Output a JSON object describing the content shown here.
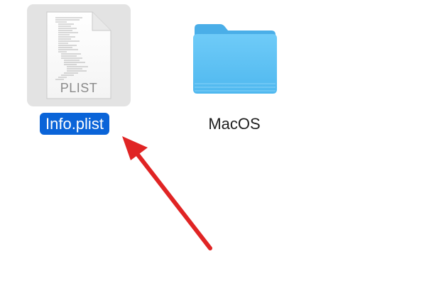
{
  "files": [
    {
      "name": "Info.plist",
      "icon": "plist-document-icon",
      "type_label": "PLIST",
      "selected": true
    },
    {
      "name": "MacOS",
      "icon": "folder-icon",
      "selected": false
    }
  ],
  "colors": {
    "selection": "#0a64d8",
    "folder": "#5ec2f5",
    "arrow": "#e02424"
  }
}
